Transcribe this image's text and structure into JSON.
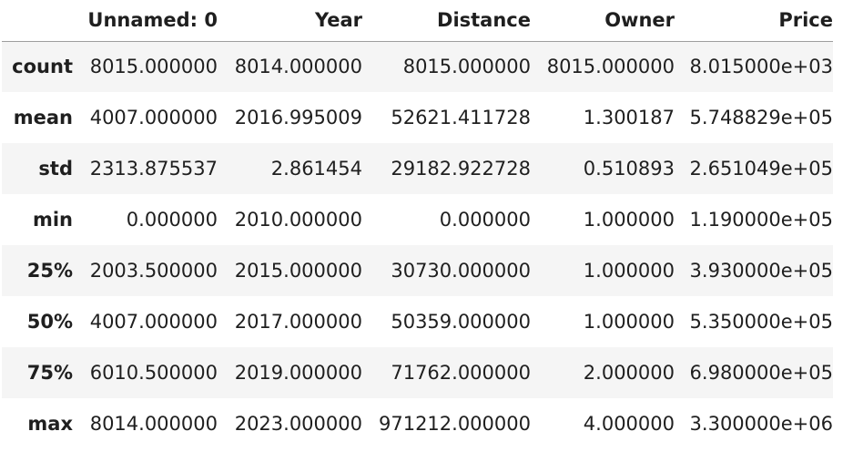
{
  "table": {
    "corner_label": "",
    "columns": [
      "Unnamed: 0",
      "Year",
      "Distance",
      "Owner",
      "Price"
    ],
    "rows": [
      {
        "index": "count",
        "values": [
          "8015.000000",
          "8014.000000",
          "8015.000000",
          "8015.000000",
          "8.015000e+03"
        ]
      },
      {
        "index": "mean",
        "values": [
          "4007.000000",
          "2016.995009",
          "52621.411728",
          "1.300187",
          "5.748829e+05"
        ]
      },
      {
        "index": "std",
        "values": [
          "2313.875537",
          "2.861454",
          "29182.922728",
          "0.510893",
          "2.651049e+05"
        ]
      },
      {
        "index": "min",
        "values": [
          "0.000000",
          "2010.000000",
          "0.000000",
          "1.000000",
          "1.190000e+05"
        ]
      },
      {
        "index": "25%",
        "values": [
          "2003.500000",
          "2015.000000",
          "30730.000000",
          "1.000000",
          "3.930000e+05"
        ]
      },
      {
        "index": "50%",
        "values": [
          "4007.000000",
          "2017.000000",
          "50359.000000",
          "1.000000",
          "5.350000e+05"
        ]
      },
      {
        "index": "75%",
        "values": [
          "6010.500000",
          "2019.000000",
          "71762.000000",
          "2.000000",
          "6.980000e+05"
        ]
      },
      {
        "index": "max",
        "values": [
          "8014.000000",
          "2023.000000",
          "971212.000000",
          "4.000000",
          "3.300000e+06"
        ]
      }
    ]
  }
}
